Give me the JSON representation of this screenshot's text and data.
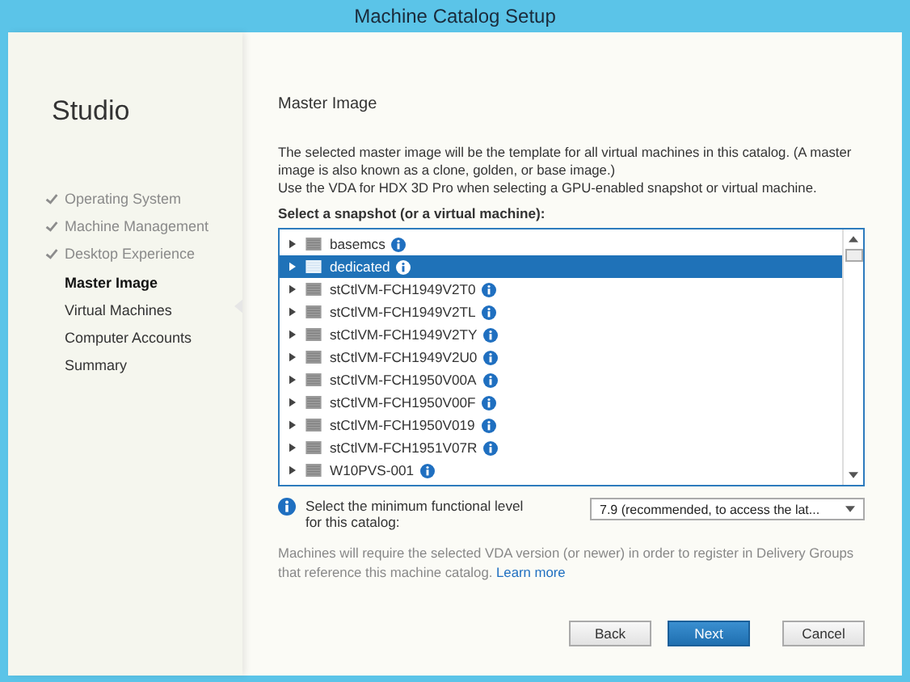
{
  "window": {
    "title": "Machine Catalog Setup"
  },
  "sidebar": {
    "title": "Studio",
    "steps": [
      {
        "label": "Operating System",
        "completed": true,
        "selected": false
      },
      {
        "label": "Machine Management",
        "completed": true,
        "selected": false
      },
      {
        "label": "Desktop Experience",
        "completed": true,
        "selected": false
      },
      {
        "label": "Master Image",
        "completed": false,
        "selected": true
      },
      {
        "label": "Virtual Machines",
        "completed": false,
        "selected": false
      },
      {
        "label": "Computer Accounts",
        "completed": false,
        "selected": false
      },
      {
        "label": "Summary",
        "completed": false,
        "selected": false
      }
    ]
  },
  "page": {
    "heading": "Master Image",
    "description": [
      "The selected master image will be the template for all virtual machines in this catalog. (A master image is also known as a clone, golden, or base image.)",
      "Use the VDA for HDX 3D Pro when selecting a GPU-enabled snapshot or virtual machine."
    ],
    "list_label": "Select a snapshot (or a virtual machine):",
    "snapshots": [
      {
        "name": "basemcs",
        "selected": false
      },
      {
        "name": "dedicated",
        "selected": true
      },
      {
        "name": "stCtlVM-FCH1949V2T0",
        "selected": false
      },
      {
        "name": "stCtlVM-FCH1949V2TL",
        "selected": false
      },
      {
        "name": "stCtlVM-FCH1949V2TY",
        "selected": false
      },
      {
        "name": "stCtlVM-FCH1949V2U0",
        "selected": false
      },
      {
        "name": "stCtlVM-FCH1950V00A",
        "selected": false
      },
      {
        "name": "stCtlVM-FCH1950V00F",
        "selected": false
      },
      {
        "name": "stCtlVM-FCH1950V019",
        "selected": false
      },
      {
        "name": "stCtlVM-FCH1951V07R",
        "selected": false
      },
      {
        "name": "W10PVS-001",
        "selected": false
      }
    ],
    "level_label": "Select the minimum functional level for this catalog:",
    "level_value": "7.9 (recommended, to access the lat...",
    "note": "Machines will require the selected VDA version (or newer) in order to register in Delivery Groups that reference this machine catalog.",
    "note_link": "Learn more"
  },
  "buttons": [
    {
      "label": "Back",
      "primary": false
    },
    {
      "label": "Next",
      "primary": true
    },
    {
      "label": "Cancel",
      "primary": false
    }
  ]
}
